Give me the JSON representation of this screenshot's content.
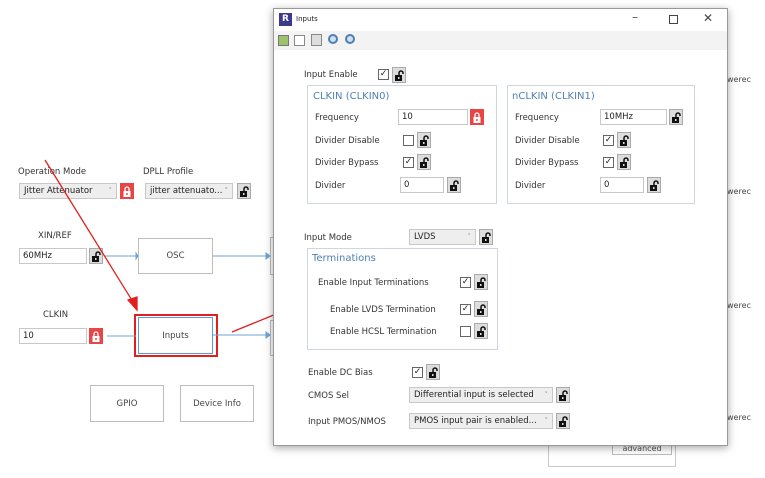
{
  "background": {
    "operation_mode": {
      "label": "Operation Mode",
      "value": "Jitter Attenuator"
    },
    "dpll_profile": {
      "label": "DPLL Profile",
      "value": "jitter attenuato..."
    },
    "xin_ref": {
      "label": "XIN/REF",
      "value": "60MHz"
    },
    "clkin": {
      "label": "CLKIN",
      "value": "10"
    },
    "blocks": {
      "osc": "OSC",
      "inputs": "Inputs",
      "gpio": "GPIO",
      "device_info": "Device Info"
    },
    "right_text": "werec",
    "advanced_button": "advanced"
  },
  "window": {
    "title": "Inputs",
    "app_icon": "R",
    "input_enable": {
      "label": "Input Enable",
      "checked": true
    },
    "clkin0": {
      "title": "CLKIN (CLKIN0)",
      "frequency_label": "Frequency",
      "frequency": "10",
      "divider_disable_label": "Divider Disable",
      "divider_disable": false,
      "divider_bypass_label": "Divider Bypass",
      "divider_bypass": true,
      "divider_label": "Divider",
      "divider": "0"
    },
    "clkin1": {
      "title": "nCLKIN (CLKIN1)",
      "frequency_label": "Frequency",
      "frequency": "10MHz",
      "divider_disable_label": "Divider Disable",
      "divider_disable": true,
      "divider_bypass_label": "Divider Bypass",
      "divider_bypass": true,
      "divider_label": "Divider",
      "divider": "0"
    },
    "input_mode": {
      "label": "Input Mode",
      "value": "LVDS"
    },
    "terminations": {
      "title": "Terminations",
      "enable_input": "Enable Input Terminations",
      "enable_lvds": "Enable LVDS Termination",
      "enable_hcsl": "Enable HCSL Termination"
    },
    "dc_bias": {
      "label": "Enable DC Bias",
      "checked": true
    },
    "cmos_sel": {
      "label": "CMOS Sel",
      "value": "Differential input is selected"
    },
    "pmos_nmos": {
      "label": "Input PMOS/NMOS",
      "value": "PMOS input pair is enabled..."
    }
  },
  "colors": {
    "accent": "#4f7fb5",
    "lock_red": "#e84646",
    "annotation": "#e02020"
  }
}
